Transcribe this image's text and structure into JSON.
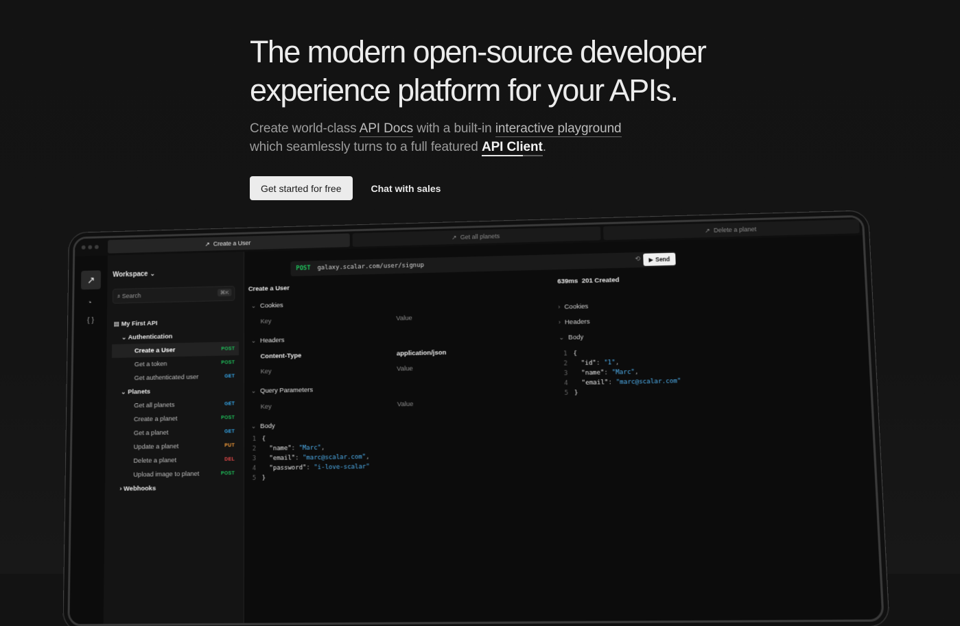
{
  "hero": {
    "title_line1": "The modern open-source developer",
    "title_line2": "experience platform for your APIs.",
    "sub_part1": "Create world-class ",
    "sub_link1": "API Docs",
    "sub_part2": " with a built-in ",
    "sub_link2": "interactive playground",
    "sub_part3": "which seamlessly turns to a full featured ",
    "sub_link3": "API Client",
    "sub_part4": ".",
    "cta_primary": "Get started for free",
    "cta_secondary": "Chat with sales"
  },
  "app": {
    "tabs": [
      {
        "label": "Create a User",
        "icon": "arrow-up-right-icon"
      },
      {
        "label": "Get all planets",
        "icon": "arrow-up-right-icon"
      },
      {
        "label": "Delete a planet",
        "icon": "arrow-up-right-icon"
      }
    ],
    "workspace_label": "Workspace",
    "search_placeholder": "Search",
    "search_shortcut": "⌘K",
    "collection": "My First API",
    "folders": [
      {
        "label": "Authentication",
        "items": [
          {
            "label": "Create a User",
            "method": "POST"
          },
          {
            "label": "Get a token",
            "method": "POST"
          },
          {
            "label": "Get authenticated user",
            "method": "GET"
          }
        ]
      },
      {
        "label": "Planets",
        "items": [
          {
            "label": "Get all planets",
            "method": "GET"
          },
          {
            "label": "Create a planet",
            "method": "POST"
          },
          {
            "label": "Get a planet",
            "method": "GET"
          },
          {
            "label": "Update a planet",
            "method": "PUT"
          },
          {
            "label": "Delete a planet",
            "method": "DEL"
          },
          {
            "label": "Upload image to planet",
            "method": "POST"
          }
        ]
      },
      {
        "label": "Webhooks",
        "items": []
      }
    ],
    "request": {
      "method": "POST",
      "url": "galaxy.scalar.com/user/signup",
      "send_label": "Send",
      "title": "Create a User",
      "cookies_label": "Cookies",
      "headers_label": "Headers",
      "query_label": "Query Parameters",
      "body_label": "Body",
      "key_placeholder": "Key",
      "value_placeholder": "Value",
      "header_key": "Content-Type",
      "header_value": "application/json",
      "body_lines": [
        {
          "n": "1",
          "text": "{"
        },
        {
          "n": "2",
          "key": "\"name\"",
          "val": "\"Marc\"",
          "comma": ","
        },
        {
          "n": "3",
          "key": "\"email\"",
          "val": "\"marc@scalar.com\"",
          "comma": ","
        },
        {
          "n": "4",
          "key": "\"password\"",
          "val": "\"i-love-scalar\"",
          "comma": ""
        },
        {
          "n": "5",
          "text": "}"
        }
      ]
    },
    "response": {
      "time": "639ms",
      "status": "201 Created",
      "cookies_label": "Cookies",
      "headers_label": "Headers",
      "body_label": "Body",
      "body_lines": [
        {
          "n": "1",
          "text": "{"
        },
        {
          "n": "2",
          "key": "\"id\"",
          "val": "\"1\"",
          "comma": ","
        },
        {
          "n": "3",
          "key": "\"name\"",
          "val": "\"Marc\"",
          "comma": ","
        },
        {
          "n": "4",
          "key": "\"email\"",
          "val": "\"marc@scalar.com\"",
          "comma": ""
        },
        {
          "n": "5",
          "text": "}"
        }
      ]
    }
  }
}
